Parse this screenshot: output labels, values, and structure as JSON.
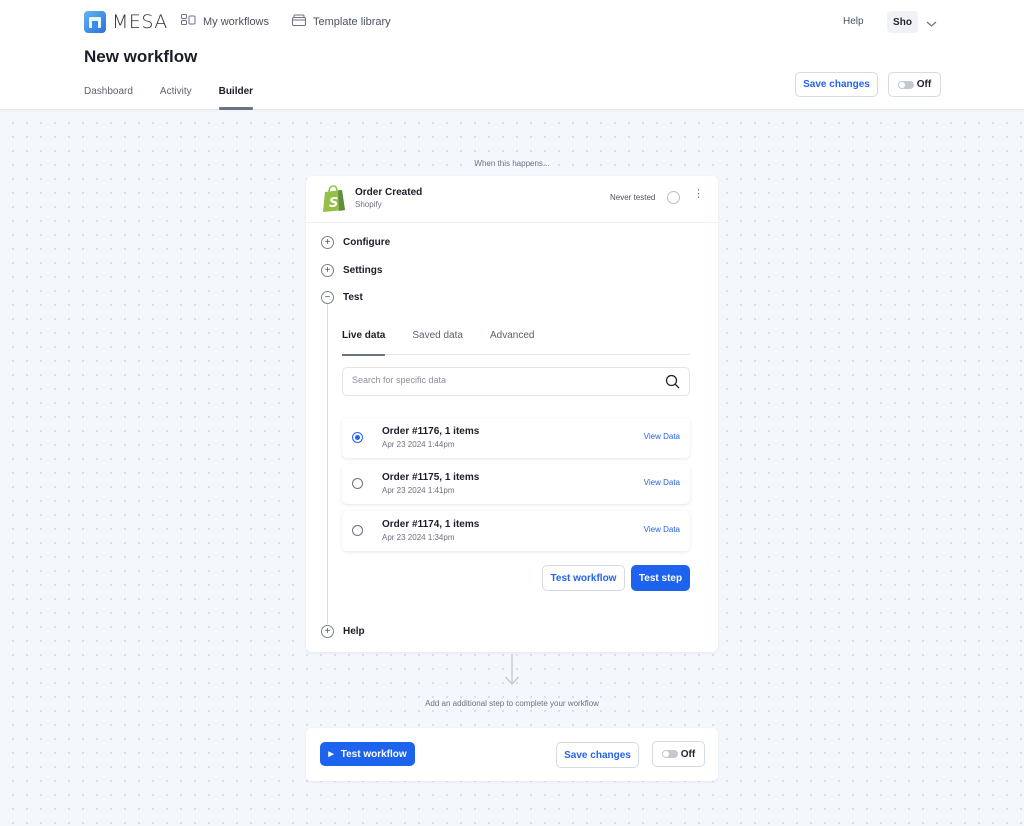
{
  "app": {
    "brand": "MESA",
    "brand_color": "#2f80e0",
    "accent_color": "#1d63ed"
  },
  "topnav": {
    "items": [
      {
        "label": "My workflows",
        "icon": "workflows-icon"
      },
      {
        "label": "Template library",
        "icon": "template-library-icon"
      }
    ],
    "help_label": "Help",
    "user_label": "Sho"
  },
  "page": {
    "title": "New workflow",
    "tabs": [
      {
        "label": "Dashboard",
        "active": false
      },
      {
        "label": "Activity",
        "active": false
      },
      {
        "label": "Builder",
        "active": true
      }
    ],
    "save_label": "Save changes",
    "toggle_label": "Off"
  },
  "builder": {
    "trigger_intro": "When this happens...",
    "trigger": {
      "title": "Order Created",
      "app": "Shopify",
      "status": "Never tested"
    },
    "sections": [
      {
        "label": "Configure",
        "expanded": false
      },
      {
        "label": "Settings",
        "expanded": false
      },
      {
        "label": "Test",
        "expanded": true
      },
      {
        "label": "Help",
        "expanded": false
      }
    ],
    "test": {
      "tabs": [
        {
          "label": "Live data",
          "active": true
        },
        {
          "label": "Saved data",
          "active": false
        },
        {
          "label": "Advanced",
          "active": false
        }
      ],
      "search_placeholder": "Search for specific data",
      "search_value": "",
      "orders": [
        {
          "title": "Order #1176, 1 items",
          "time": "Apr 23 2024 1:44pm",
          "selected": true,
          "action": "View Data"
        },
        {
          "title": "Order #1175, 1 items",
          "time": "Apr 23 2024 1:41pm",
          "selected": false,
          "action": "View Data"
        },
        {
          "title": "Order #1174, 1 items",
          "time": "Apr 23 2024 1:34pm",
          "selected": false,
          "action": "View Data"
        }
      ],
      "test_workflow_label": "Test workflow",
      "test_step_label": "Test step"
    },
    "add_step_hint": "Add an additional step to complete your workflow"
  },
  "footer": {
    "test_workflow_label": "Test workflow",
    "save_label": "Save changes",
    "toggle_label": "Off"
  }
}
